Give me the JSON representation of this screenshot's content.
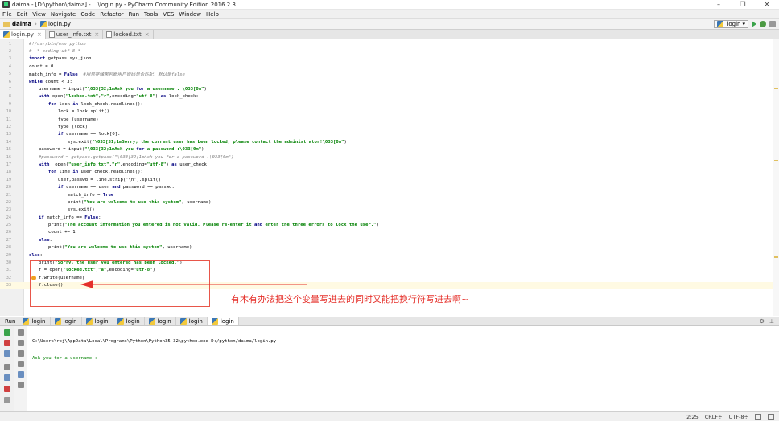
{
  "window": {
    "title": "daima - [D:\\python\\daima] - ...\\login.py - PyCharm Community Edition 2016.2.3",
    "minimize": "–",
    "maximize": "❐",
    "close": "✕"
  },
  "menu": [
    "File",
    "Edit",
    "View",
    "Navigate",
    "Code",
    "Refactor",
    "Run",
    "Tools",
    "VCS",
    "Window",
    "Help"
  ],
  "navbar": {
    "project": "daima",
    "file": "login.py",
    "run_config": "login",
    "run_config_arrow": "▾"
  },
  "tabs": [
    {
      "label": "login.py",
      "close": "×"
    },
    {
      "label": "user_info.txt",
      "close": "×"
    },
    {
      "label": "locked.txt",
      "close": "×"
    }
  ],
  "code": [
    {
      "n": "1",
      "t": "#!/usr/bin/env python",
      "c": "cmt",
      "i": 0
    },
    {
      "n": "2",
      "t": "# -*-coding:utf-8-*-",
      "c": "cmt",
      "i": 0
    },
    {
      "n": "3",
      "t": "import getpass,sys,json",
      "c": "kw-first",
      "i": 0
    },
    {
      "n": "4",
      "t": "count = 0",
      "c": "plain",
      "i": 0
    },
    {
      "n": "5",
      "t": "match_info = False  #用来存储来判断用户密码是否匹配，默认是false",
      "c": "plain",
      "i": 0
    },
    {
      "n": "6",
      "t": "while count < 3:",
      "c": "kw-first",
      "i": 0
    },
    {
      "n": "7",
      "t": "username = input(\"\\033[32;1mAsk you for a username : \\033[0m\")",
      "c": "plain",
      "i": 1
    },
    {
      "n": "8",
      "t": "with open(\"locked.txt\",\"r\",encoding=\"utf-8\") as lock_check:",
      "c": "kw-first",
      "i": 1
    },
    {
      "n": "9",
      "t": "for lock in lock_check.readlines():",
      "c": "kw-first",
      "i": 2
    },
    {
      "n": "10",
      "t": "lock = lock.split()",
      "c": "plain",
      "i": 3
    },
    {
      "n": "11",
      "t": "type (username)",
      "c": "plain",
      "i": 3
    },
    {
      "n": "12",
      "t": "type (lock)",
      "c": "plain",
      "i": 3
    },
    {
      "n": "13",
      "t": "if username == lock[0]:",
      "c": "kw-first",
      "i": 3
    },
    {
      "n": "14",
      "t": "sys.exit(\"\\033[31;1mSorry, the current user has been locked, please contact the administrator!\\033[0m\")",
      "c": "plain",
      "i": 4
    },
    {
      "n": "15",
      "t": "password = input(\"\\033[32;1mAsk you for a password :\\033[0m\")",
      "c": "plain",
      "i": 1
    },
    {
      "n": "16",
      "t": "#password = getpass.getpass(\"\\033[32;1mAsk you for a password :\\033[0m\")",
      "c": "cmt",
      "i": 1
    },
    {
      "n": "17",
      "t": "with  open(\"user_info.txt\",\"r\",encoding=\"utf-8\") as user_check:",
      "c": "kw-first",
      "i": 1
    },
    {
      "n": "18",
      "t": "for line in user_check.readlines():",
      "c": "kw-first",
      "i": 2
    },
    {
      "n": "19",
      "t": "user,passwd = line.strip('\\n').split()",
      "c": "plain",
      "i": 3
    },
    {
      "n": "20",
      "t": "if username == user and password == passwd:",
      "c": "kw-first",
      "i": 3
    },
    {
      "n": "21",
      "t": "match_info = True",
      "c": "plain",
      "i": 4
    },
    {
      "n": "22",
      "t": "print(\"You are welcome to use this system\", username)",
      "c": "plain",
      "i": 4
    },
    {
      "n": "23",
      "t": "sys.exit()",
      "c": "plain",
      "i": 4
    },
    {
      "n": "24",
      "t": "if match_info == False:",
      "c": "kw-first",
      "i": 1
    },
    {
      "n": "25",
      "t": "print(\"The account information you entered is not valid. Please re-enter it and enter the three errors to lock the user.\")",
      "c": "plain",
      "i": 2
    },
    {
      "n": "26",
      "t": "count += 1",
      "c": "plain",
      "i": 2
    },
    {
      "n": "27",
      "t": "else:",
      "c": "kw-first",
      "i": 1
    },
    {
      "n": "28",
      "t": "print(\"You are welcome to use this system\", username)",
      "c": "plain",
      "i": 2
    },
    {
      "n": "29",
      "t": "else:",
      "c": "kw-first",
      "i": 0
    },
    {
      "n": "30",
      "t": "print(\"Sorry, the user you entered has been locked.\")",
      "c": "plain",
      "i": 1
    },
    {
      "n": "31",
      "t": "f = open(\"locked.txt\",\"a\",encoding=\"utf-8\")",
      "c": "plain",
      "i": 1
    },
    {
      "n": "32",
      "t": "f.write(username)",
      "c": "plain",
      "i": 1
    },
    {
      "n": "33",
      "t": "f.close()",
      "c": "plain",
      "i": 1
    }
  ],
  "annotation": "有木有办法把这个变量写进去的同时又能把换行符写进去啊~",
  "run_panel": {
    "label": "Run",
    "tabs": [
      "login",
      "login",
      "login",
      "login",
      "login",
      "login",
      "login"
    ],
    "settings": "⚙",
    "hide": "⊥",
    "output": [
      "C:\\Users\\rcj\\AppData\\Local\\Programs\\Python\\Python35-32\\python.exe D:/python/daima/login.py",
      "Ask you for a username :"
    ]
  },
  "status": {
    "position": "2:25",
    "line_sep": "CRLF÷",
    "encoding": "UTF-8÷"
  },
  "colors": {
    "annotation": "#e5302a",
    "console_prompt": "#008000",
    "keyword": "#000080",
    "string": "#008000"
  }
}
